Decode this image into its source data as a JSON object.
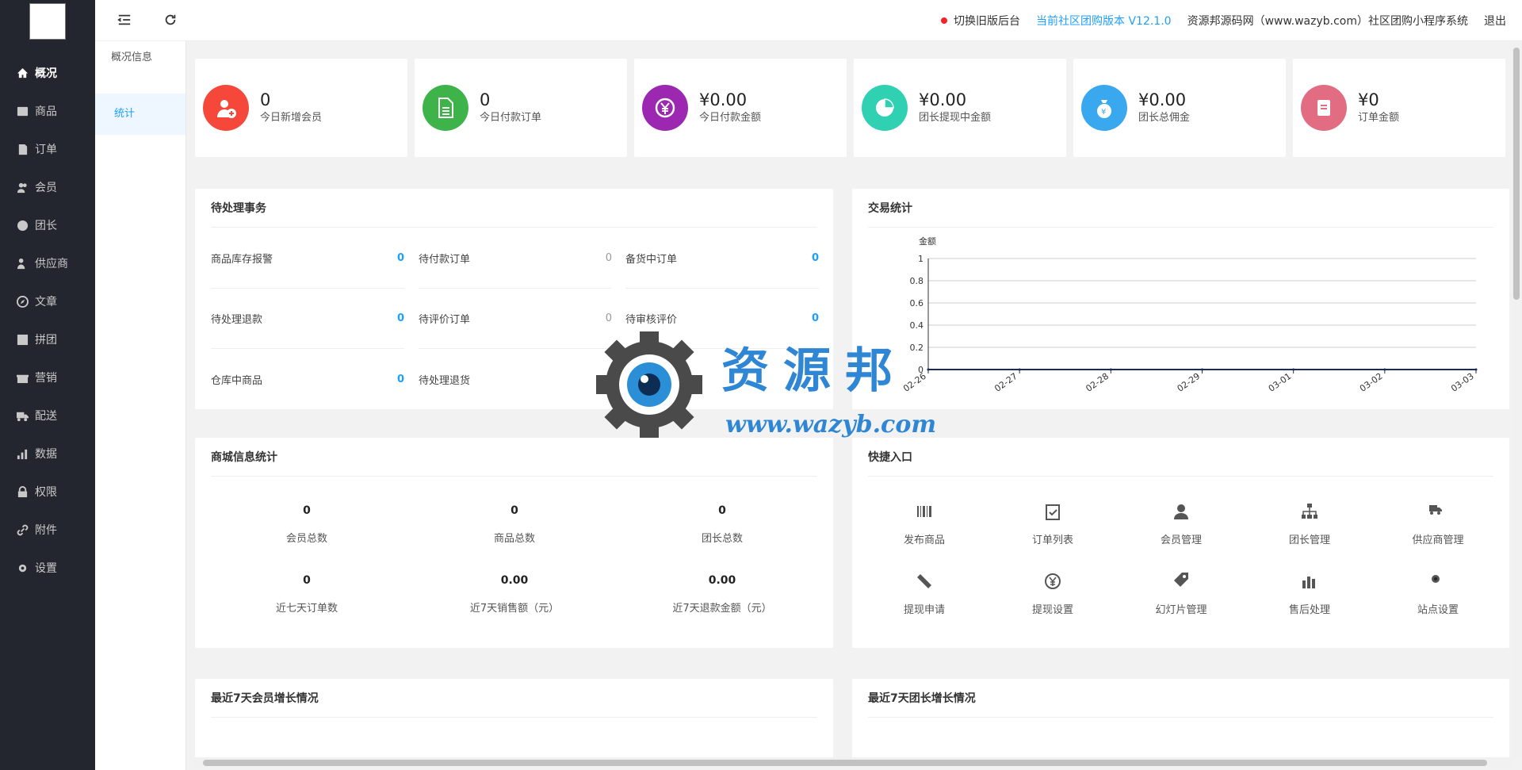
{
  "sidebar": {
    "items": [
      {
        "label": "概况",
        "icon": "home-icon",
        "active": true
      },
      {
        "label": "商品",
        "icon": "goods-icon"
      },
      {
        "label": "订单",
        "icon": "order-icon"
      },
      {
        "label": "会员",
        "icon": "member-icon"
      },
      {
        "label": "团长",
        "icon": "leader-icon"
      },
      {
        "label": "供应商",
        "icon": "supplier-icon"
      },
      {
        "label": "文章",
        "icon": "compass-icon"
      },
      {
        "label": "拼团",
        "icon": "group-icon"
      },
      {
        "label": "营销",
        "icon": "gift-icon"
      },
      {
        "label": "配送",
        "icon": "truck-icon"
      },
      {
        "label": "数据",
        "icon": "chart-icon"
      },
      {
        "label": "权限",
        "icon": "lock-icon"
      },
      {
        "label": "附件",
        "icon": "link-icon"
      },
      {
        "label": "设置",
        "icon": "gear-icon"
      }
    ]
  },
  "subnav": {
    "title": "概况信息",
    "items": [
      {
        "label": "统计"
      }
    ]
  },
  "header": {
    "switch_old": "切换旧版后台",
    "version": "当前社区团购版本 V12.1.0",
    "site": "资源邦源码网（www.wazyb.com）社区团购小程序系统",
    "logout": "退出"
  },
  "stats": [
    {
      "value": "0",
      "label": "今日新增会员",
      "color": "#f5483b",
      "icon": "add-user-icon"
    },
    {
      "value": "0",
      "label": "今日付款订单",
      "color": "#3db34a",
      "icon": "document-icon"
    },
    {
      "value": "¥0.00",
      "label": "今日付款金额",
      "color": "#9c27b0",
      "icon": "yen-icon"
    },
    {
      "value": "¥0.00",
      "label": "团长提现中金额",
      "color": "#2fd1b2",
      "icon": "pie-icon"
    },
    {
      "value": "¥0.00",
      "label": "团长总佣金",
      "color": "#3aa8ee",
      "icon": "money-bag-icon"
    },
    {
      "value": "¥0",
      "label": "订单金额",
      "color": "#e26c82",
      "icon": "receipt-icon"
    }
  ],
  "todo": {
    "title": "待处理事务",
    "items": [
      {
        "label": "商品库存报警",
        "value": "0",
        "grey": false
      },
      {
        "label": "待付款订单",
        "value": "0",
        "grey": true
      },
      {
        "label": "备货中订单",
        "value": "0",
        "grey": false
      },
      {
        "label": "待处理退款",
        "value": "0",
        "grey": false
      },
      {
        "label": "待评价订单",
        "value": "0",
        "grey": true
      },
      {
        "label": "待审核评价",
        "value": "0",
        "grey": false
      },
      {
        "label": "仓库中商品",
        "value": "0",
        "grey": false
      },
      {
        "label": "待处理退货",
        "value": "",
        "grey": true
      }
    ]
  },
  "trade": {
    "title": "交易统计",
    "chart_data": {
      "type": "line",
      "ylabel": "金额",
      "categories": [
        "02-26",
        "02-27",
        "02-28",
        "02-29",
        "03-01",
        "03-02",
        "03-03"
      ],
      "series": [
        {
          "values": [
            0,
            0,
            0,
            0,
            0,
            0,
            0
          ]
        }
      ],
      "ylim": [
        0,
        1
      ],
      "yticks": [
        "0",
        "0.2",
        "0.4",
        "0.6",
        "0.8",
        "1"
      ],
      "grid": true
    }
  },
  "mall": {
    "title": "商城信息统计",
    "items": [
      {
        "value": "0",
        "label": "会员总数"
      },
      {
        "value": "0",
        "label": "商品总数"
      },
      {
        "value": "0",
        "label": "团长总数"
      },
      {
        "value": "0",
        "label": "近七天订单数"
      },
      {
        "value": "0.00",
        "label": "近7天销售额（元）"
      },
      {
        "value": "0.00",
        "label": "近7天退款金额（元）"
      }
    ]
  },
  "quick": {
    "title": "快捷入口",
    "items": [
      {
        "label": "发布商品",
        "icon": "barcode-icon"
      },
      {
        "label": "订单列表",
        "icon": "clipboard-check-icon"
      },
      {
        "label": "会员管理",
        "icon": "member-manage-icon"
      },
      {
        "label": "团长管理",
        "icon": "org-chart-icon"
      },
      {
        "label": "供应商管理",
        "icon": "truck-icon"
      },
      {
        "label": "提现申请",
        "icon": "ticket-icon"
      },
      {
        "label": "提现设置",
        "icon": "yen-circle-icon"
      },
      {
        "label": "幻灯片管理",
        "icon": "tag-icon"
      },
      {
        "label": "售后处理",
        "icon": "bar-blocks-icon"
      },
      {
        "label": "站点设置",
        "icon": "gear-icon"
      }
    ]
  },
  "member_growth": {
    "title": "最近7天会员增长情况"
  },
  "leader_growth": {
    "title": "最近7天团长增长情况"
  },
  "watermark": {
    "brand": "资源邦",
    "url": "www.wazyb.com"
  }
}
